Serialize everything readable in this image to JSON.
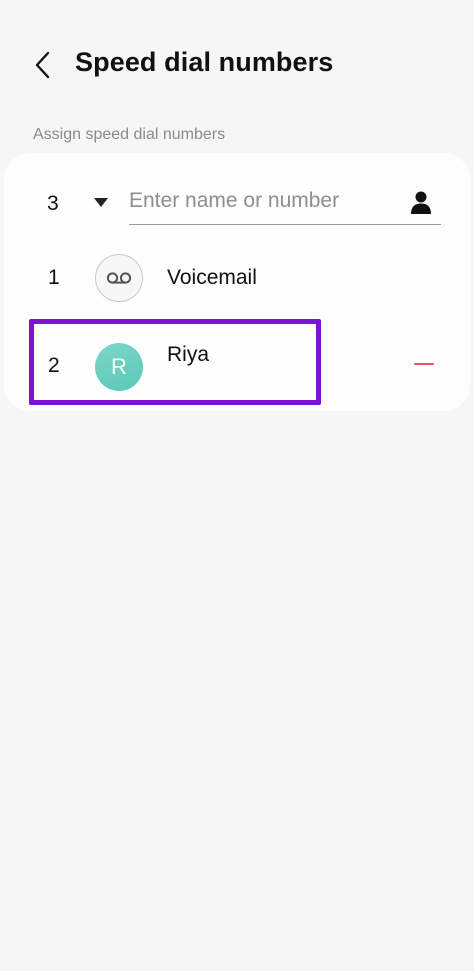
{
  "header": {
    "title": "Speed dial numbers",
    "back_icon": "chevron-left-icon"
  },
  "section": {
    "label": "Assign speed dial numbers"
  },
  "assign_row": {
    "number": "3",
    "dropdown_icon": "caret-down-icon",
    "input_placeholder": "Enter name or number",
    "input_value": "",
    "contact_icon": "person-icon"
  },
  "entries": [
    {
      "number": "1",
      "avatar_icon": "voicemail-icon",
      "name": "Voicemail"
    },
    {
      "number": "2",
      "avatar_initial": "R",
      "name": "Riya",
      "remove_icon": "minus-icon",
      "remove_color": "#e0535f"
    }
  ],
  "colors": {
    "background": "#f6f6f6",
    "card": "#fdfdfd",
    "highlight_border": "#7a12d4",
    "avatar_riya": "#66ccbc"
  }
}
